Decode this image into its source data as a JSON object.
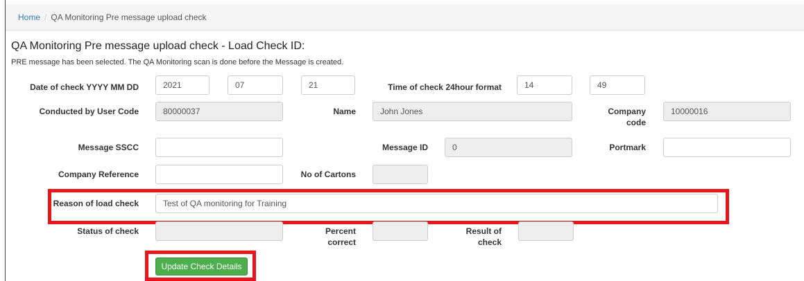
{
  "breadcrumb": {
    "home": "Home",
    "separator": "/",
    "current": "QA Monitoring Pre message upload check"
  },
  "page": {
    "title": "QA Monitoring Pre message upload check - Load Check ID:",
    "subtitle": "PRE message has been selected. The QA Monitoring scan is done before the Message is created."
  },
  "form": {
    "date_label": "Date of check YYYY MM DD",
    "date_year": "2021",
    "date_month": "07",
    "date_day": "21",
    "time_label": "Time of check 24hour format",
    "time_hour": "14",
    "time_minute": "49",
    "user_code_label": "Conducted by User Code",
    "user_code": "80000037",
    "name_label": "Name",
    "name": "John Jones",
    "company_code_label_1": "Company",
    "company_code_label_2": "code",
    "company_code": "10000016",
    "sscc_label": "Message SSCC",
    "sscc": "",
    "message_id_label": "Message ID",
    "message_id": "0",
    "portmark_label": "Portmark",
    "portmark": "",
    "company_ref_label": "Company Reference",
    "company_ref": "",
    "cartons_label": "No of Cartons",
    "cartons": "",
    "reason_label": "Reason of load check",
    "reason": "Test of QA monitoring for Training",
    "status_label": "Status of check",
    "status": "",
    "percent_label_1": "Percent",
    "percent_label_2": "correct",
    "percent": "",
    "result_label_1": "Result of",
    "result_label_2": "check",
    "result": ""
  },
  "actions": {
    "update_label": "Update Check Details"
  },
  "colors": {
    "highlight": "#e8151b",
    "button": "#4cae4c",
    "link": "#337ab7"
  }
}
